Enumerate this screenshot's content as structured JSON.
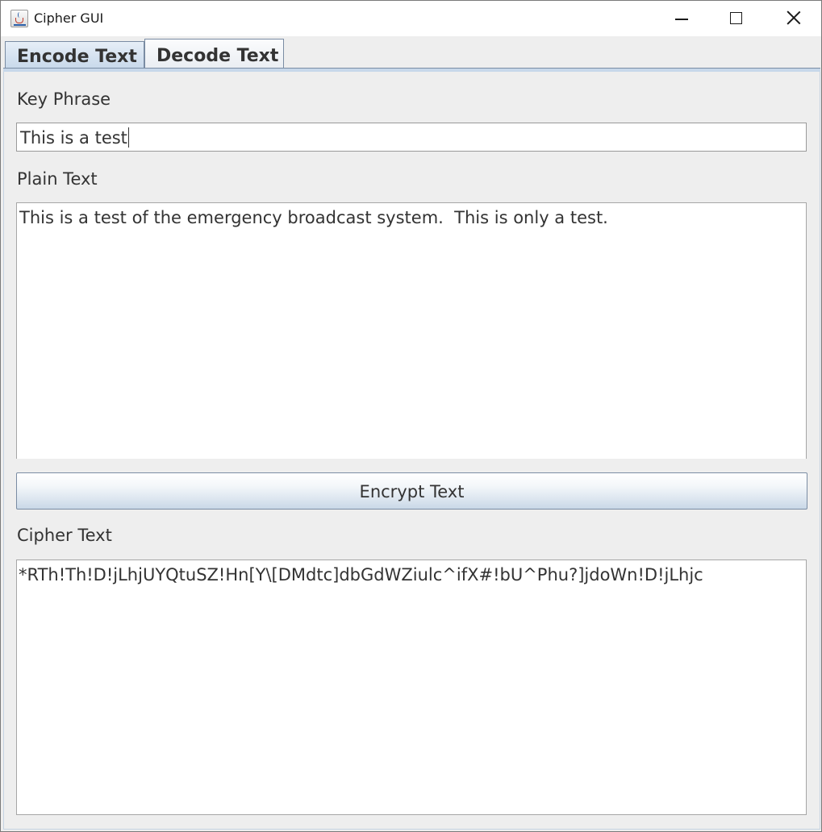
{
  "window": {
    "title": "Cipher GUI",
    "app_icon": "java-cup-icon"
  },
  "tabs": [
    {
      "label": "Encode Text",
      "selected": true
    },
    {
      "label": "Decode Text",
      "selected": false
    }
  ],
  "encode": {
    "key_phrase_label": "Key Phrase",
    "key_phrase_value": "This is a test",
    "plain_text_label": "Plain Text",
    "plain_text_value": "This is a test of the emergency broadcast system.  This is only a test.",
    "encrypt_button_label": "Encrypt Text",
    "cipher_text_label": "Cipher Text",
    "cipher_text_value": "*RTh!Th!D!jLhjUYQtuSZ!Hn[Y\\[DMdtc]dbGdWZiulc^ifX#!bU^Phu?]jdoWn!D!jLhjc"
  },
  "colors": {
    "tab_selected": "#c7d8ea",
    "panel_bg": "#eeeeee",
    "border": "#7a8ca3"
  }
}
